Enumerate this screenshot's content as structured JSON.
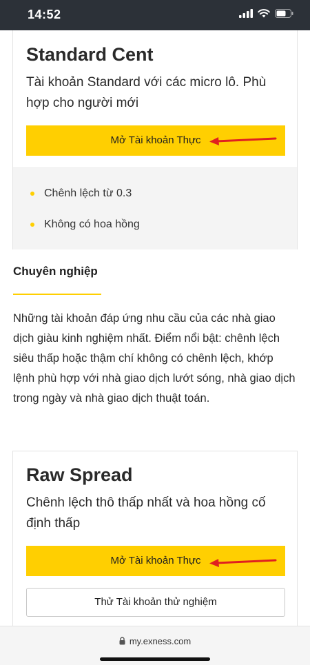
{
  "status_bar": {
    "time": "14:52"
  },
  "cards": [
    {
      "title": "Standard Cent",
      "description": "Tài khoản Standard với các micro lô. Phù hợp cho người mới",
      "primary_button": "Mở Tài khoản Thực",
      "features": [
        "Chênh lệch từ 0.3",
        "Không có hoa hồng"
      ]
    },
    {
      "title": "Raw Spread",
      "description": "Chênh lệch thô thấp nhất và hoa hồng cố định thấp",
      "primary_button": "Mở Tài khoản Thực",
      "secondary_button": "Thử Tài khoản thử nghiệm"
    }
  ],
  "section": {
    "title": "Chuyên nghiệp",
    "body": "Những tài khoản đáp ứng nhu cầu của các nhà giao dịch giàu kinh nghiệm nhất. Điểm nổi bật: chênh lệch siêu thấp hoặc thậm chí không có chênh lệch, khớp lệnh phù hợp với nhà giao dịch lướt sóng, nhà giao dịch trong ngày và nhà giao dịch thuật toán."
  },
  "url_bar": {
    "url": "my.exness.com"
  },
  "colors": {
    "accent": "#ffcf01",
    "annotation": "#e02020",
    "status_bar": "#2c3138"
  },
  "icons": [
    "signal-icon",
    "wifi-icon",
    "battery-icon",
    "lock-icon",
    "red-arrow-annotation"
  ]
}
